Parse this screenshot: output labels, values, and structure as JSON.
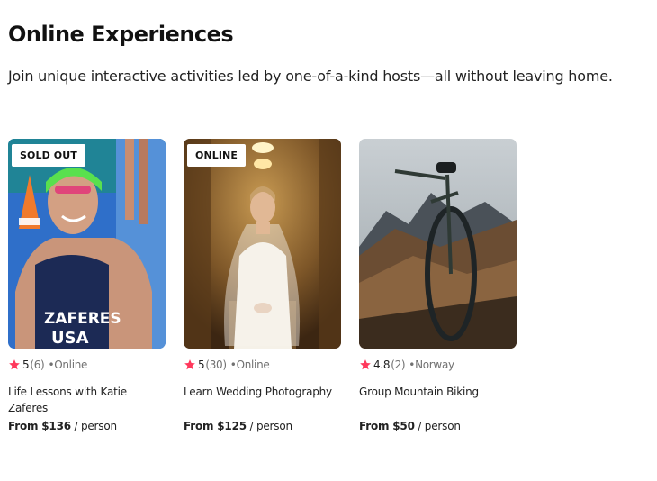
{
  "header": {
    "title": "Online Experiences",
    "subtitle": "Join unique interactive activities led by one-of-a-kind hosts—all without leaving home."
  },
  "colors": {
    "star": "#FF385C",
    "muted_text": "#717171"
  },
  "cards": [
    {
      "badge": "SOLD OUT",
      "rating": "5",
      "review_count": "(6)",
      "separator": "•",
      "location": "Online",
      "name": "Life Lessons with Katie Zaferes",
      "price_from": "From $136",
      "price_unit": " / person",
      "image_text_1": "ZAFERES",
      "image_text_2": "USA"
    },
    {
      "badge": "ONLINE",
      "rating": "5",
      "review_count": "(30)",
      "separator": "•",
      "location": "Online",
      "name": "Learn Wedding Photography",
      "price_from": "From $125",
      "price_unit": " / person"
    },
    {
      "rating": "4.8",
      "review_count": "(2)",
      "separator": "•",
      "location": "Norway",
      "name": "Group Mountain Biking",
      "price_from": "From $50",
      "price_unit": " / person"
    }
  ]
}
